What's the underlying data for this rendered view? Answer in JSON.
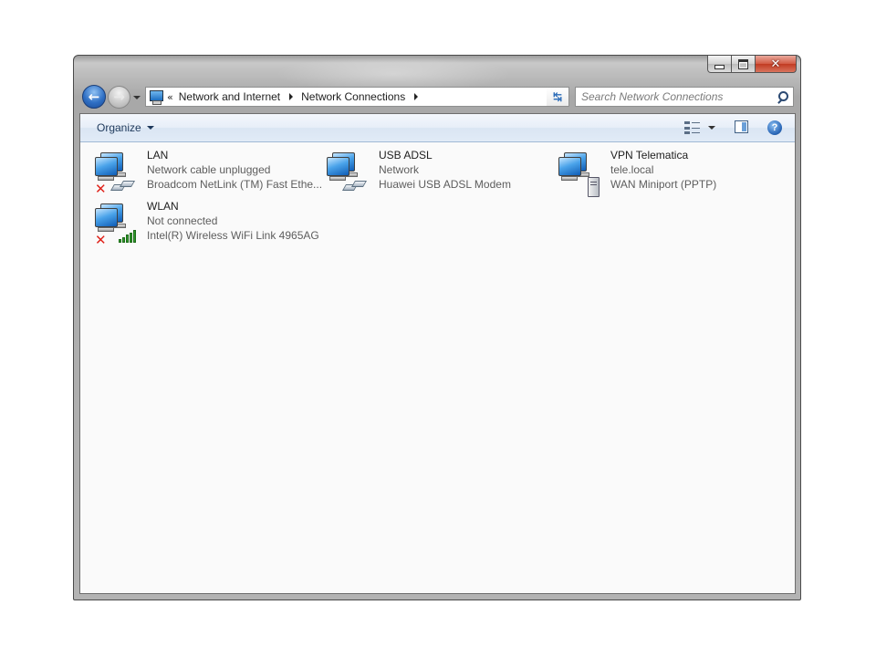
{
  "window": {
    "caption_buttons": [
      "minimize",
      "maximize",
      "close"
    ],
    "close_glyph": "✕"
  },
  "nav": {
    "back_icon": "back-arrow-icon",
    "forward_icon": "forward-arrow-icon",
    "back_glyph": "←",
    "forward_glyph": "→"
  },
  "address": {
    "overflow": "«",
    "crumbs": [
      "Network and Internet",
      "Network Connections"
    ]
  },
  "search": {
    "placeholder": "Search Network Connections"
  },
  "toolbar": {
    "organize_label": "Organize",
    "help_glyph": "?"
  },
  "connections": [
    {
      "name": "LAN",
      "status": "Network cable unplugged",
      "device": "Broadcom NetLink (TM) Fast Ethe...",
      "state": "disconnected",
      "adapter": "ethernet"
    },
    {
      "name": "USB ADSL",
      "status": "Network",
      "device": "Huawei USB ADSL Modem",
      "state": "connected",
      "adapter": "ethernet"
    },
    {
      "name": "VPN Telematica",
      "status": "tele.local",
      "device": "WAN Miniport (PPTP)",
      "state": "connected",
      "adapter": "vpn"
    },
    {
      "name": "WLAN",
      "status": "Not connected",
      "device": "Intel(R) Wireless WiFi Link 4965AG",
      "state": "disconnected",
      "adapter": "wireless"
    }
  ],
  "colors": {
    "accent": "#2f6fc4",
    "error": "#e0231b",
    "signal": "#2f9b2b"
  }
}
